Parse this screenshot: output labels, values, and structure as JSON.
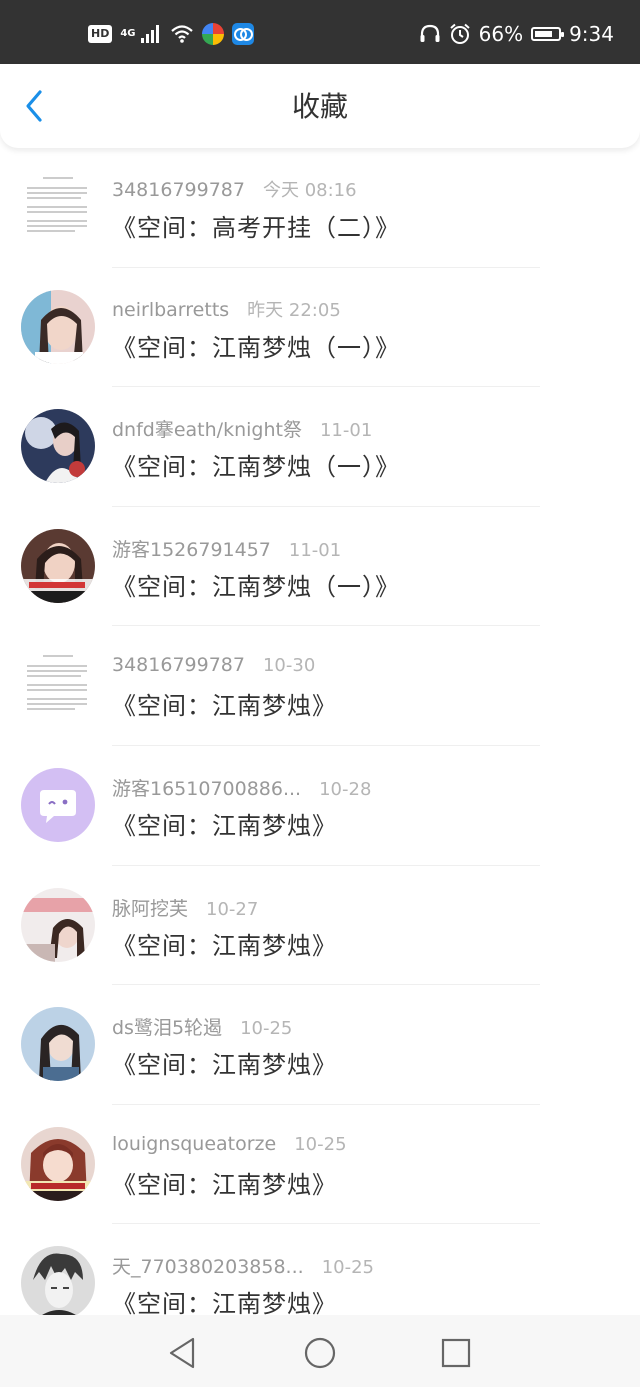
{
  "status_bar": {
    "hd": "HD",
    "network": "4G",
    "battery": "66%",
    "time": "9:34",
    "icons": [
      "hd-icon",
      "signal-icon",
      "wifi-icon",
      "app-icon-multicolor",
      "app-icon-blue",
      "headphones-icon",
      "alarm-icon",
      "battery-icon"
    ]
  },
  "header": {
    "title": "收藏",
    "back_icon": "chevron-left-icon",
    "accent_color": "#1a8fe8"
  },
  "items": [
    {
      "user": "34816799787",
      "time": "今天 08:16",
      "title": "《空间：高考开挂（二）》",
      "avatar": "document-thumbnail"
    },
    {
      "user": "neirlbarretts",
      "time": "昨天 22:05",
      "title": "《空间：江南梦烛（一）》",
      "avatar": "user-photo"
    },
    {
      "user": "dnfd搴eath/knight祭",
      "time": "11-01",
      "title": "《空间：江南梦烛（一）》",
      "avatar": "user-photo"
    },
    {
      "user": "游客1526791457",
      "time": "11-01",
      "title": "《空间：江南梦烛（一）》",
      "avatar": "user-photo"
    },
    {
      "user": "34816799787",
      "time": "10-30",
      "title": "《空间：江南梦烛》",
      "avatar": "document-thumbnail"
    },
    {
      "user": "游客16510700886...",
      "time": "10-28",
      "title": "《空间：江南梦烛》",
      "avatar": "default-chat-avatar"
    },
    {
      "user": "脉阿挖芙",
      "time": "10-27",
      "title": "《空间：江南梦烛》",
      "avatar": "user-photo"
    },
    {
      "user": "ds鹭泪5轮遏",
      "time": "10-25",
      "title": "《空间：江南梦烛》",
      "avatar": "user-photo"
    },
    {
      "user": "louignsqueatorze",
      "time": "10-25",
      "title": "《空间：江南梦烛》",
      "avatar": "user-photo"
    },
    {
      "user": "天_770380203858...",
      "time": "10-25",
      "title": "《空间：江南梦烛》",
      "avatar": "user-photo"
    }
  ],
  "nav_bar": {
    "icons": [
      "nav-back-icon",
      "nav-home-icon",
      "nav-recent-icon"
    ]
  }
}
